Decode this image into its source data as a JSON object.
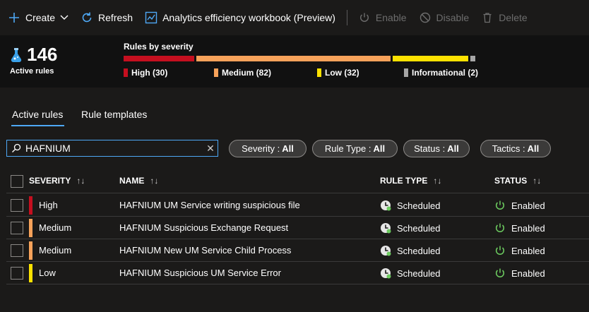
{
  "toolbar": {
    "create": "Create",
    "refresh": "Refresh",
    "workbook": "Analytics efficiency workbook (Preview)",
    "enable": "Enable",
    "disable": "Disable",
    "delete": "Delete"
  },
  "summary": {
    "count": "146",
    "count_label": "Active rules",
    "severity_title": "Rules by severity",
    "levels": [
      {
        "label": "High (30)",
        "value": 30,
        "color": "#c50f1f"
      },
      {
        "label": "Medium (82)",
        "value": 82,
        "color": "#f7a25a"
      },
      {
        "label": "Low (32)",
        "value": 32,
        "color": "#fce100"
      },
      {
        "label": "Informational (2)",
        "value": 2,
        "color": "#a6a6a6"
      }
    ]
  },
  "tabs": [
    {
      "label": "Active rules",
      "active": true
    },
    {
      "label": "Rule templates",
      "active": false
    }
  ],
  "search": {
    "value": "HAFNIUM"
  },
  "filters": [
    {
      "key": "Severity :",
      "value": "All"
    },
    {
      "key": "Rule Type :",
      "value": "All"
    },
    {
      "key": "Status :",
      "value": "All"
    },
    {
      "key": "Tactics :",
      "value": "All"
    }
  ],
  "columns": {
    "severity": "SEVERITY",
    "name": "NAME",
    "rule_type": "RULE TYPE",
    "status": "STATUS",
    "sort_icon": "↑↓"
  },
  "rows": [
    {
      "severity": "High",
      "severity_color": "#c50f1f",
      "name": "HAFNIUM UM Service writing suspicious file",
      "rule_type": "Scheduled",
      "status": "Enabled"
    },
    {
      "severity": "Medium",
      "severity_color": "#f7a25a",
      "name": "HAFNIUM Suspicious Exchange Request",
      "rule_type": "Scheduled",
      "status": "Enabled"
    },
    {
      "severity": "Medium",
      "severity_color": "#f7a25a",
      "name": "HAFNIUM New UM Service Child Process",
      "rule_type": "Scheduled",
      "status": "Enabled"
    },
    {
      "severity": "Low",
      "severity_color": "#fce100",
      "name": "HAFNIUM Suspicious UM Service Error",
      "rule_type": "Scheduled",
      "status": "Enabled"
    }
  ],
  "colors": {
    "accent": "#4ea8f5",
    "enabled_green": "#6ccb5f"
  }
}
